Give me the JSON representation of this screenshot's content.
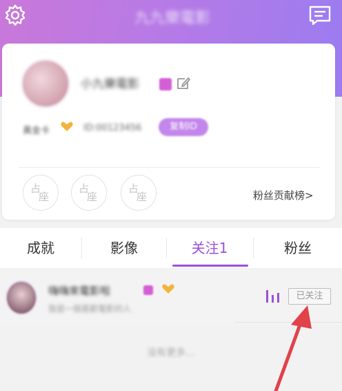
{
  "header": {
    "title": "九九樂電影",
    "settings_icon": "gear-icon",
    "message_icon": "message-icon",
    "gradient_start": "#c978d9",
    "gradient_end": "#9b7cf0"
  },
  "profile": {
    "nickname": "小九樂電影",
    "level_text": "黃金卡",
    "uid": "ID:00123456",
    "copy_id_label": "复制ID",
    "fans_rank_link": "粉丝贡献榜>",
    "badges": [
      {
        "top": "占",
        "bottom": "座"
      },
      {
        "top": "占",
        "bottom": "座"
      },
      {
        "top": "占",
        "bottom": "座"
      }
    ]
  },
  "tabs": [
    {
      "label": "成就",
      "active": false
    },
    {
      "label": "影像",
      "active": false
    },
    {
      "label": "关注1",
      "active": true
    },
    {
      "label": "粉丝",
      "active": false
    }
  ],
  "following": [
    {
      "name": "嗨嗨來電影啦",
      "subtitle": "我是一個喜歡電影的人",
      "status_label": "已关注"
    }
  ],
  "no_more_text": "没有更多...",
  "colors": {
    "accent": "#9b4fd9",
    "copy_id_bg": "#c386ec",
    "arrow": "#e2424a"
  }
}
